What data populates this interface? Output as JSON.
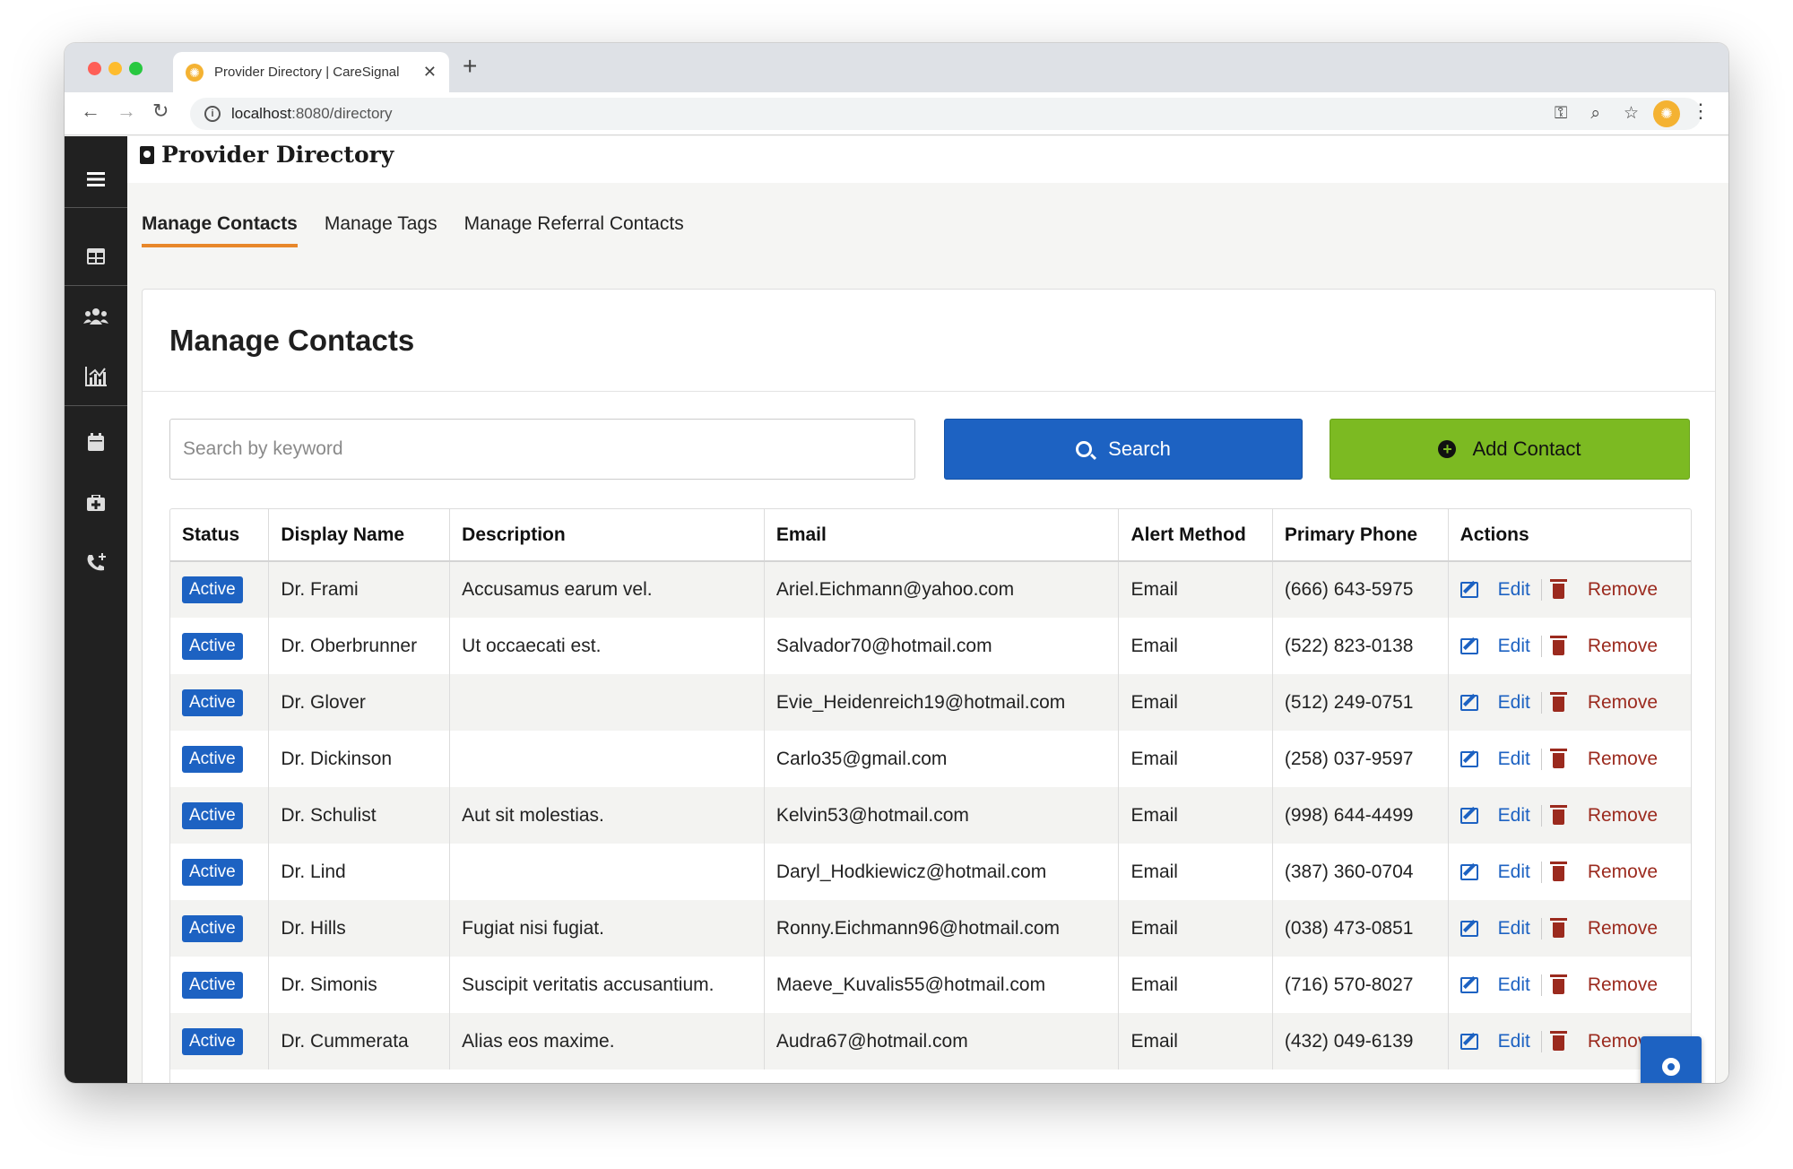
{
  "browser": {
    "tab_title": "Provider Directory | CareSignal",
    "url_host": "localhost",
    "url_path": ":8080/directory"
  },
  "app": {
    "title": "Provider Directory",
    "tabs": [
      {
        "label": "Manage Contacts",
        "active": true
      },
      {
        "label": "Manage Tags",
        "active": false
      },
      {
        "label": "Manage Referral Contacts",
        "active": false
      }
    ],
    "sidebar_icons": [
      "menu-icon",
      "dashboard-icon",
      "users-icon",
      "analytics-icon",
      "calendar-icon",
      "medkit-icon",
      "phone-icon"
    ]
  },
  "card": {
    "title": "Manage Contacts",
    "search_placeholder": "Search by keyword",
    "search_button": "Search",
    "add_button": "Add Contact"
  },
  "table": {
    "headers": [
      "Status",
      "Display Name",
      "Description",
      "Email",
      "Alert Method",
      "Primary Phone",
      "Actions"
    ],
    "edit_label": "Edit",
    "remove_label": "Remove",
    "rows": [
      {
        "status": "Active",
        "name": "Dr. Frami",
        "description": "Accusamus earum vel.",
        "email": "Ariel.Eichmann@yahoo.com",
        "alert": "Email",
        "phone": "(666) 643-5975"
      },
      {
        "status": "Active",
        "name": "Dr. Oberbrunner",
        "description": "Ut occaecati est.",
        "email": "Salvador70@hotmail.com",
        "alert": "Email",
        "phone": "(522) 823-0138"
      },
      {
        "status": "Active",
        "name": "Dr. Glover",
        "description": "",
        "email": "Evie_Heidenreich19@hotmail.com",
        "alert": "Email",
        "phone": "(512) 249-0751"
      },
      {
        "status": "Active",
        "name": "Dr. Dickinson",
        "description": "",
        "email": "Carlo35@gmail.com",
        "alert": "Email",
        "phone": "(258) 037-9597"
      },
      {
        "status": "Active",
        "name": "Dr. Schulist",
        "description": "Aut sit molestias.",
        "email": "Kelvin53@hotmail.com",
        "alert": "Email",
        "phone": "(998) 644-4499"
      },
      {
        "status": "Active",
        "name": "Dr. Lind",
        "description": "",
        "email": "Daryl_Hodkiewicz@hotmail.com",
        "alert": "Email",
        "phone": "(387) 360-0704"
      },
      {
        "status": "Active",
        "name": "Dr. Hills",
        "description": "Fugiat nisi fugiat.",
        "email": "Ronny.Eichmann96@hotmail.com",
        "alert": "Email",
        "phone": "(038) 473-0851"
      },
      {
        "status": "Active",
        "name": "Dr. Simonis",
        "description": "Suscipit veritatis accusantium.",
        "email": "Maeve_Kuvalis55@hotmail.com",
        "alert": "Email",
        "phone": "(716) 570-8027"
      },
      {
        "status": "Active",
        "name": "Dr. Cummerata",
        "description": "Alias eos maxime.",
        "email": "Audra67@hotmail.com",
        "alert": "Email",
        "phone": "(432) 049-6139"
      }
    ]
  },
  "colors": {
    "primary": "#1d62c2",
    "success": "#7cba22",
    "danger": "#9b2a1e",
    "tab_accent": "#e8872a",
    "sidebar": "#212121"
  }
}
